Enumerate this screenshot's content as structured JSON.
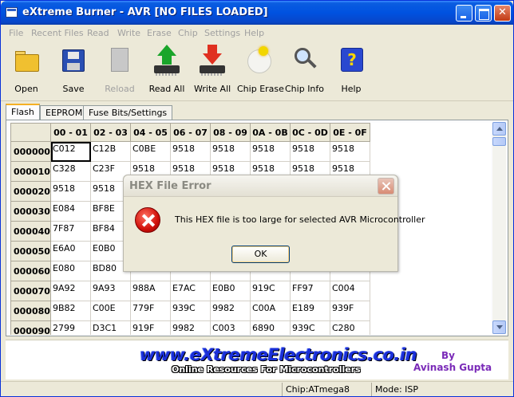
{
  "window": {
    "title": "eXtreme Burner - AVR [NO FILES LOADED]"
  },
  "menu": [
    "File",
    "Recent Files",
    "Read",
    "Write",
    "Erase",
    "Chip",
    "Settings",
    "Help"
  ],
  "toolbar": [
    {
      "label": "Open",
      "icon": "folder-open-icon",
      "enabled": true
    },
    {
      "label": "Save",
      "icon": "floppy-save-icon",
      "enabled": true
    },
    {
      "label": "Reload",
      "icon": "reload-document-icon",
      "enabled": false
    },
    {
      "label": "Read All",
      "icon": "read-chip-arrow-up-icon",
      "enabled": true
    },
    {
      "label": "Write All",
      "icon": "write-chip-arrow-down-icon",
      "enabled": true
    },
    {
      "label": "Chip Erase",
      "icon": "chip-erase-icon",
      "enabled": true
    },
    {
      "label": "Chip Info",
      "icon": "magnifier-chip-info-icon",
      "enabled": true
    },
    {
      "label": "Help",
      "icon": "help-question-icon",
      "enabled": true
    }
  ],
  "tabs": [
    {
      "label": "Flash",
      "active": true
    },
    {
      "label": "EEPROM",
      "active": false
    },
    {
      "label": "Fuse Bits/Settings",
      "active": false
    }
  ],
  "grid": {
    "columns": [
      "00 - 01",
      "02 - 03",
      "04 - 05",
      "06 - 07",
      "08 - 09",
      "0A - 0B",
      "0C - 0D",
      "0E - 0F"
    ],
    "rows": [
      {
        "addr": "000000",
        "cells": [
          "C012",
          "C12B",
          "C0BE",
          "9518",
          "9518",
          "9518",
          "9518",
          "9518"
        ]
      },
      {
        "addr": "000010",
        "cells": [
          "C328",
          "C23F",
          "9518",
          "9518",
          "9518",
          "9518",
          "9518",
          "9518"
        ]
      },
      {
        "addr": "000020",
        "cells": [
          "9518",
          "9518",
          "",
          "",
          "",
          "",
          "",
          ""
        ]
      },
      {
        "addr": "000030",
        "cells": [
          "E084",
          "BF8E",
          "",
          "",
          "",
          "",
          "",
          ""
        ]
      },
      {
        "addr": "000040",
        "cells": [
          "7F87",
          "BF84",
          "",
          "",
          "",
          "",
          "",
          ""
        ]
      },
      {
        "addr": "000050",
        "cells": [
          "E6A0",
          "E0B0",
          "",
          "",
          "",
          "",
          "",
          ""
        ]
      },
      {
        "addr": "000060",
        "cells": [
          "E080",
          "BD80",
          "",
          "",
          "",
          "",
          "",
          ""
        ]
      },
      {
        "addr": "000070",
        "cells": [
          "9A92",
          "9A93",
          "988A",
          "E7AC",
          "E0B0",
          "919C",
          "FF97",
          "C004"
        ]
      },
      {
        "addr": "000080",
        "cells": [
          "9B82",
          "C00E",
          "779F",
          "939C",
          "9982",
          "C00A",
          "E189",
          "939F"
        ]
      },
      {
        "addr": "000090",
        "cells": [
          "2799",
          "D3C1",
          "919F",
          "9982",
          "C003",
          "6890",
          "939C",
          "C280"
        ]
      }
    ]
  },
  "banner": {
    "url": "www.eXtremeElectronics.co.in",
    "tagline": "Online Resources For Microcontrollers",
    "by": "By",
    "author": "Avinash Gupta"
  },
  "status": {
    "chip": "Chip:ATmega8",
    "mode": "Mode: ISP"
  },
  "dialog": {
    "title": "HEX File Error",
    "message": "This HEX file is too large for selected AVR Microcontroller",
    "ok_label": "OK"
  },
  "colors": {
    "titlebar": "#0052e0",
    "window_bg": "#ece9d8",
    "banner_url": "#1a2fd8",
    "author": "#7a2ab8"
  }
}
